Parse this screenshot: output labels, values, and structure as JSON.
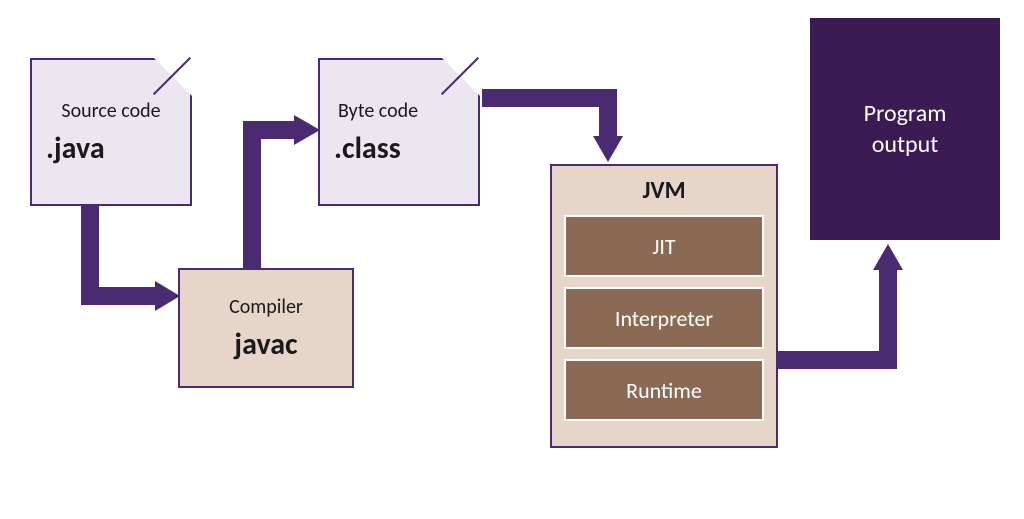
{
  "source_file": {
    "label": "Source code",
    "ext": ".java"
  },
  "compiler": {
    "label": "Compiler",
    "name": "javac"
  },
  "byte_file": {
    "label": "Byte code",
    "ext": ".class"
  },
  "jvm": {
    "title": "JVM",
    "boxes": [
      "JIT",
      "Interpreter",
      "Runtime"
    ]
  },
  "output": {
    "line1": "Program",
    "line2": "output"
  },
  "colors": {
    "purple_dark": "#4a2a71",
    "purple_fill": "#ece6f1",
    "tan_fill": "#e8d5c9",
    "brown_fill": "#8a6a55",
    "output_fill": "#3c1a54"
  }
}
